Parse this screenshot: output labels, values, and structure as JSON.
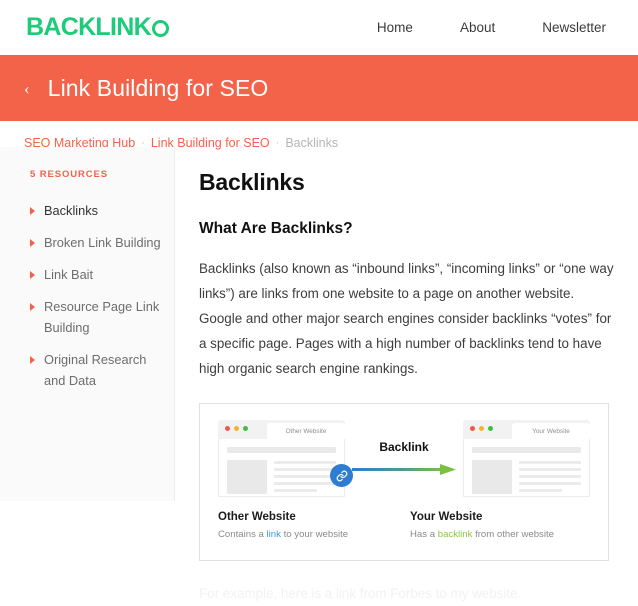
{
  "brand": {
    "logo_text": "BACKLINK",
    "logo_mark": "circle-o",
    "color": "#1ecb79"
  },
  "nav": {
    "links": [
      {
        "label": "Home"
      },
      {
        "label": "About"
      },
      {
        "label": "Newsletter"
      }
    ]
  },
  "banner": {
    "back_icon": "‹",
    "title": "Link Building for SEO",
    "background": "#f2634a"
  },
  "breadcrumb": {
    "items": [
      {
        "label": "SEO Marketing Hub",
        "current": false
      },
      {
        "label": "Link Building for SEO",
        "current": false
      },
      {
        "label": "Backlinks",
        "current": true
      }
    ],
    "separator": "·",
    "link_color": "#f2634a",
    "current_color": "#b5b5b5"
  },
  "sidebar": {
    "heading": "5 RESOURCES",
    "items": [
      {
        "label": "Backlinks",
        "active": true
      },
      {
        "label": "Broken Link Building",
        "active": false
      },
      {
        "label": "Link Bait",
        "active": false
      },
      {
        "label": "Resource Page Link Building",
        "active": false
      },
      {
        "label": "Original Research and Data",
        "active": false
      }
    ]
  },
  "main": {
    "page_title": "Backlinks",
    "section_title": "What Are Backlinks?",
    "paragraph": "Backlinks (also known as “inbound links”, “incoming links” or “one way links”) are links from one website to a page on another website. Google and other major search engines consider backlinks “votes” for a specific page. Pages with a high number of backlinks tend to have high organic search engine rankings.",
    "fade_note": "For example, here is a link from Forbes to my website."
  },
  "diagram": {
    "left_browser": {
      "tab_label": "Other Website",
      "badge_icon": "link-icon"
    },
    "right_browser": {
      "tab_label": "Your Website"
    },
    "arrow_label": "Backlink",
    "arrow_gradient_from": "#2e7dd1",
    "arrow_gradient_to": "#7ac143",
    "captions": {
      "left_title": "Other Website",
      "left_pre": "Contains a ",
      "left_link": "link",
      "left_post": " to your website",
      "right_title": "Your Website",
      "right_pre": "Has a ",
      "right_link": "backlink",
      "right_post": " from other website"
    }
  }
}
